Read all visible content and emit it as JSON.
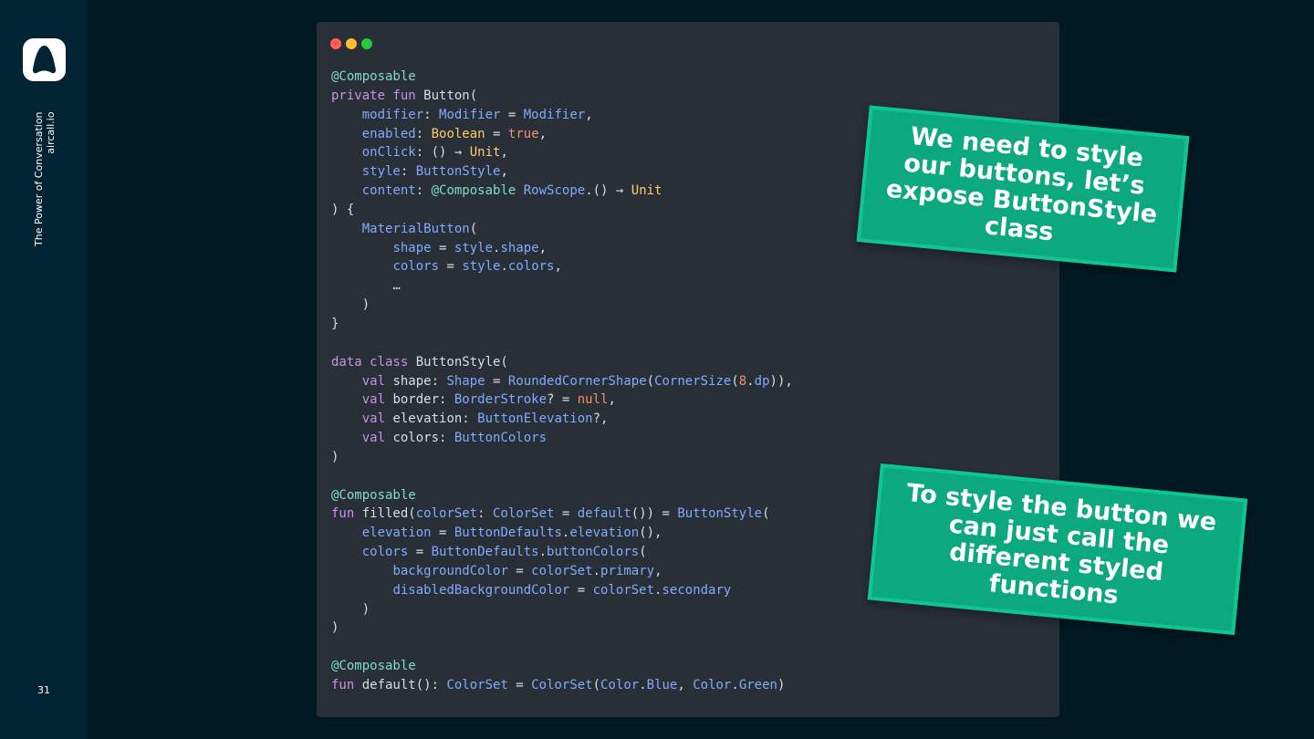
{
  "sidebar": {
    "brand_line1": "The Power of Conversation",
    "brand_line2": "aircall.io",
    "page_number": "31"
  },
  "window": {
    "controls": [
      "close",
      "minimize",
      "maximize"
    ]
  },
  "code": [
    [
      [
        "ann",
        "@Composable"
      ]
    ],
    [
      [
        "kw",
        "private fun "
      ],
      [
        "pl",
        "Button("
      ]
    ],
    [
      [
        "pl",
        "    "
      ],
      [
        "pr",
        "modifier"
      ],
      [
        "pl",
        ": "
      ],
      [
        "ty",
        "Modifier"
      ],
      [
        "pl",
        " = "
      ],
      [
        "ty",
        "Modifier"
      ],
      [
        "pl",
        ","
      ]
    ],
    [
      [
        "pl",
        "    "
      ],
      [
        "pr",
        "enabled"
      ],
      [
        "pl",
        ": "
      ],
      [
        "yl",
        "Boolean"
      ],
      [
        "pl",
        " = "
      ],
      [
        "bool",
        "true"
      ],
      [
        "pl",
        ","
      ]
    ],
    [
      [
        "pl",
        "    "
      ],
      [
        "pr",
        "onClick"
      ],
      [
        "pl",
        ": () → "
      ],
      [
        "yl",
        "Unit"
      ],
      [
        "pl",
        ","
      ]
    ],
    [
      [
        "pl",
        "    "
      ],
      [
        "pr",
        "style"
      ],
      [
        "pl",
        ": "
      ],
      [
        "ty",
        "ButtonStyle"
      ],
      [
        "pl",
        ","
      ]
    ],
    [
      [
        "pl",
        "    "
      ],
      [
        "pr",
        "content"
      ],
      [
        "pl",
        ": "
      ],
      [
        "ann",
        "@Composable "
      ],
      [
        "ty",
        "RowScope"
      ],
      [
        "pl",
        ".() → "
      ],
      [
        "yl",
        "Unit"
      ]
    ],
    [
      [
        "pl",
        ") {"
      ]
    ],
    [
      [
        "pl",
        "    "
      ],
      [
        "ty",
        "MaterialButton"
      ],
      [
        "pl",
        "("
      ]
    ],
    [
      [
        "pl",
        "        "
      ],
      [
        "pr",
        "shape"
      ],
      [
        "pl",
        " = "
      ],
      [
        "pr",
        "style"
      ],
      [
        "pl",
        "."
      ],
      [
        "pr",
        "shape"
      ],
      [
        "pl",
        ","
      ]
    ],
    [
      [
        "pl",
        "        "
      ],
      [
        "pr",
        "colors"
      ],
      [
        "pl",
        " = "
      ],
      [
        "pr",
        "style"
      ],
      [
        "pl",
        "."
      ],
      [
        "pr",
        "colors"
      ],
      [
        "pl",
        ","
      ]
    ],
    [
      [
        "pl",
        "        …"
      ]
    ],
    [
      [
        "pl",
        "    )"
      ]
    ],
    [
      [
        "pl",
        "}"
      ]
    ],
    [
      [
        "pl",
        ""
      ]
    ],
    [
      [
        "kw",
        "data class "
      ],
      [
        "pl",
        "ButtonStyle("
      ]
    ],
    [
      [
        "pl",
        "    "
      ],
      [
        "kw",
        "val "
      ],
      [
        "pl",
        "shape: "
      ],
      [
        "ty",
        "Shape"
      ],
      [
        "pl",
        " = "
      ],
      [
        "ty",
        "RoundedCornerShape"
      ],
      [
        "pl",
        "("
      ],
      [
        "ty",
        "CornerSize"
      ],
      [
        "pl",
        "("
      ],
      [
        "num",
        "8"
      ],
      [
        "pl",
        "."
      ],
      [
        "pr",
        "dp"
      ],
      [
        "pl",
        ")),"
      ]
    ],
    [
      [
        "pl",
        "    "
      ],
      [
        "kw",
        "val "
      ],
      [
        "pl",
        "border: "
      ],
      [
        "ty",
        "BorderStroke"
      ],
      [
        "pl",
        "? = "
      ],
      [
        "bool",
        "null"
      ],
      [
        "pl",
        ","
      ]
    ],
    [
      [
        "pl",
        "    "
      ],
      [
        "kw",
        "val "
      ],
      [
        "pl",
        "elevation: "
      ],
      [
        "ty",
        "ButtonElevation"
      ],
      [
        "pl",
        "?,"
      ]
    ],
    [
      [
        "pl",
        "    "
      ],
      [
        "kw",
        "val "
      ],
      [
        "pl",
        "colors: "
      ],
      [
        "ty",
        "ButtonColors"
      ]
    ],
    [
      [
        "pl",
        ")"
      ]
    ],
    [
      [
        "pl",
        ""
      ]
    ],
    [
      [
        "ann",
        "@Composable"
      ]
    ],
    [
      [
        "kw",
        "fun "
      ],
      [
        "pl",
        "filled("
      ],
      [
        "pr",
        "colorSet"
      ],
      [
        "pl",
        ": "
      ],
      [
        "ty",
        "ColorSet"
      ],
      [
        "pl",
        " = "
      ],
      [
        "pr",
        "default"
      ],
      [
        "pl",
        "()) = "
      ],
      [
        "ty",
        "ButtonStyle"
      ],
      [
        "pl",
        "("
      ]
    ],
    [
      [
        "pl",
        "    "
      ],
      [
        "pr",
        "elevation"
      ],
      [
        "pl",
        " = "
      ],
      [
        "ty",
        "ButtonDefaults"
      ],
      [
        "pl",
        "."
      ],
      [
        "pr",
        "elevation"
      ],
      [
        "pl",
        "(),"
      ]
    ],
    [
      [
        "pl",
        "    "
      ],
      [
        "pr",
        "colors"
      ],
      [
        "pl",
        " = "
      ],
      [
        "ty",
        "ButtonDefaults"
      ],
      [
        "pl",
        "."
      ],
      [
        "pr",
        "buttonColors"
      ],
      [
        "pl",
        "("
      ]
    ],
    [
      [
        "pl",
        "        "
      ],
      [
        "pr",
        "backgroundColor"
      ],
      [
        "pl",
        " = "
      ],
      [
        "pr",
        "colorSet"
      ],
      [
        "pl",
        "."
      ],
      [
        "pr",
        "primary"
      ],
      [
        "pl",
        ","
      ]
    ],
    [
      [
        "pl",
        "        "
      ],
      [
        "pr",
        "disabledBackgroundColor"
      ],
      [
        "pl",
        " = "
      ],
      [
        "pr",
        "colorSet"
      ],
      [
        "pl",
        "."
      ],
      [
        "pr",
        "secondary"
      ]
    ],
    [
      [
        "pl",
        "    )"
      ]
    ],
    [
      [
        "pl",
        ")"
      ]
    ],
    [
      [
        "pl",
        ""
      ]
    ],
    [
      [
        "ann",
        "@Composable"
      ]
    ],
    [
      [
        "kw",
        "fun "
      ],
      [
        "pl",
        "default(): "
      ],
      [
        "ty",
        "ColorSet"
      ],
      [
        "pl",
        " = "
      ],
      [
        "ty",
        "ColorSet"
      ],
      [
        "pl",
        "("
      ],
      [
        "ty",
        "Color"
      ],
      [
        "pl",
        "."
      ],
      [
        "pr",
        "Blue"
      ],
      [
        "pl",
        ", "
      ],
      [
        "ty",
        "Color"
      ],
      [
        "pl",
        "."
      ],
      [
        "pr",
        "Green"
      ],
      [
        "pl",
        ")"
      ]
    ]
  ],
  "notes": {
    "note1": "We need to style our buttons, let’s expose ButtonStyle class",
    "note2": "To style the button we can just call the different styled functions"
  },
  "colors": {
    "background": "#011923",
    "sidebar": "#022334",
    "code_bg": "#282f36",
    "note_green": "#0ba97d"
  }
}
